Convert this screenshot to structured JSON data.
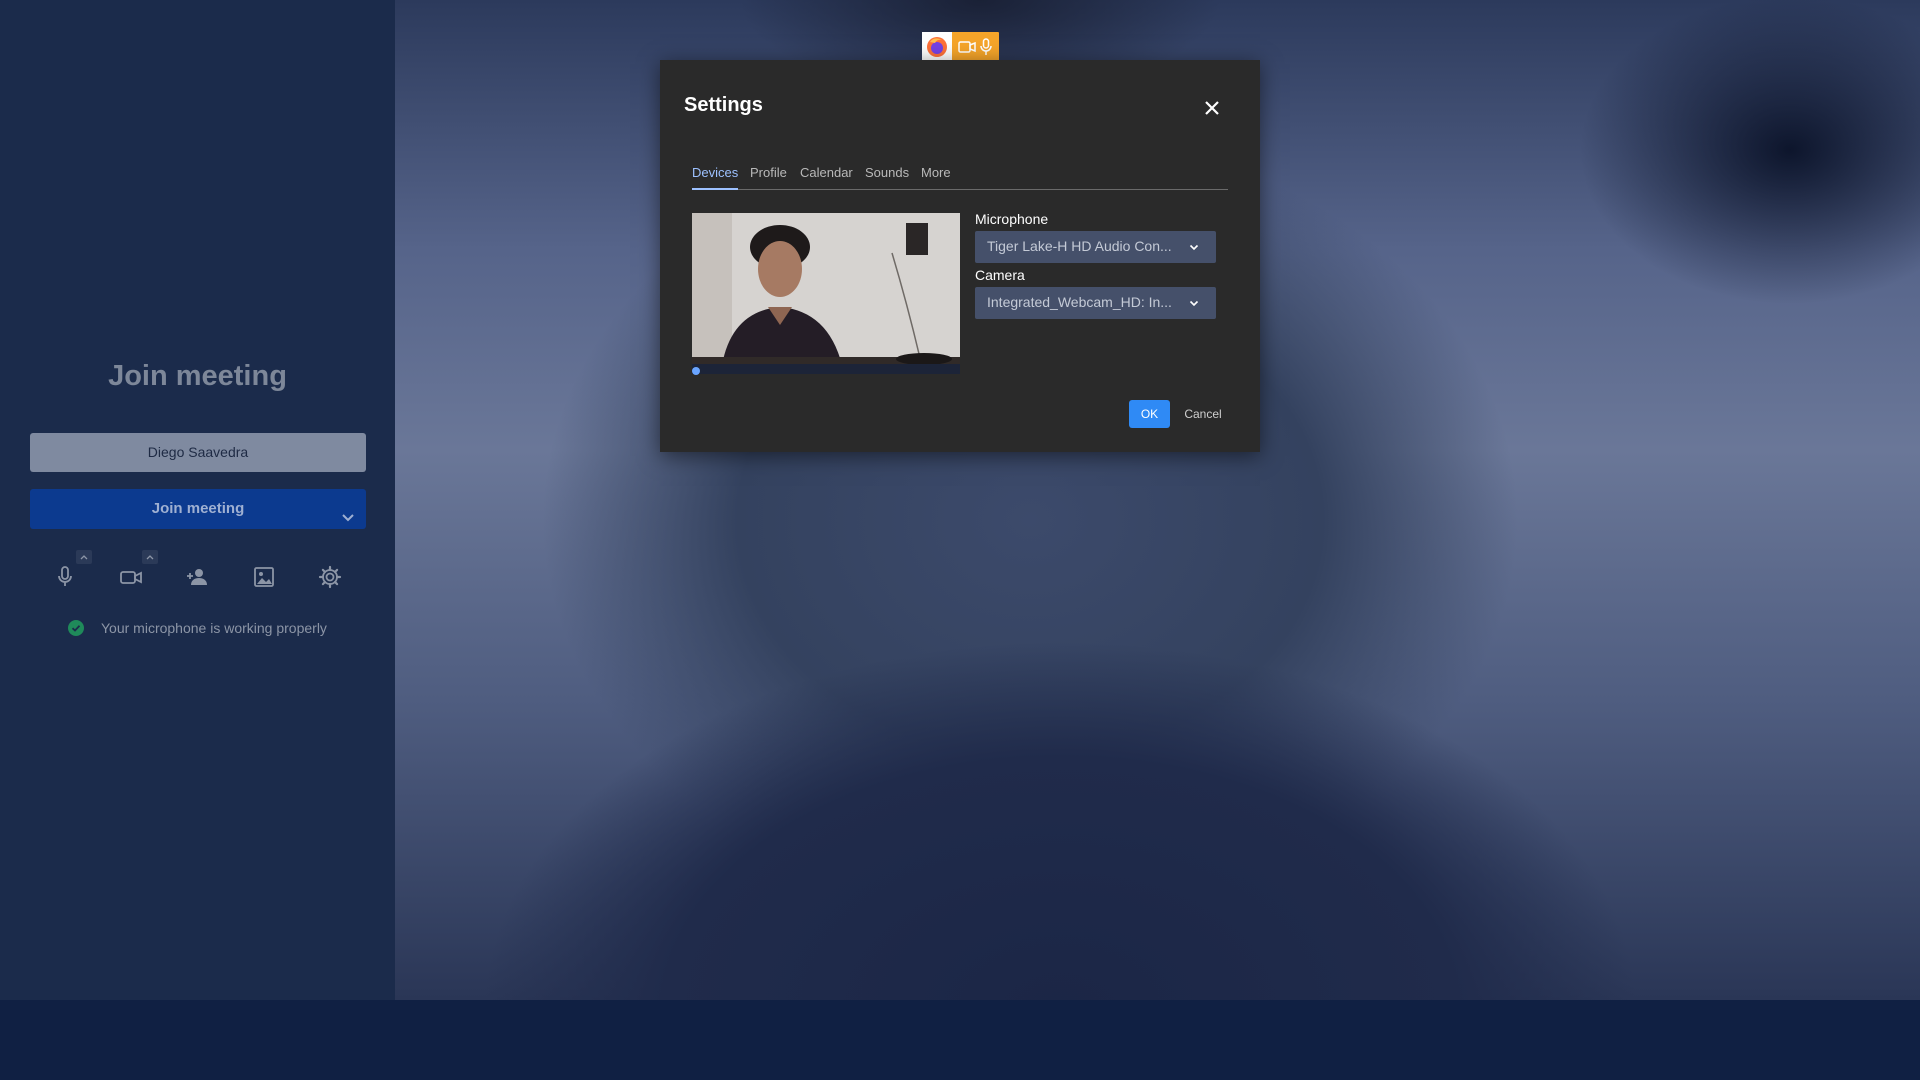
{
  "join_panel": {
    "title": "Join meeting",
    "name_value": "Diego Saavedra",
    "join_button_label": "Join meeting",
    "mic_status_text": "Your microphone is working properly"
  },
  "toolbar": {
    "icons": [
      "microphone-icon",
      "camera-icon",
      "invite-person-icon",
      "background-image-icon",
      "settings-gear-icon"
    ]
  },
  "sharing_indicator": {
    "icons": [
      "firefox-icon",
      "camera-icon",
      "microphone-icon"
    ]
  },
  "settings_dialog": {
    "title": "Settings",
    "tabs": [
      "Devices",
      "Profile",
      "Calendar",
      "Sounds",
      "More"
    ],
    "active_tab": "Devices",
    "microphone_label": "Microphone",
    "microphone_value": "Tiger Lake-H HD Audio Con...",
    "camera_label": "Camera",
    "camera_value": "Integrated_Webcam_HD: In...",
    "ok_label": "OK",
    "cancel_label": "Cancel"
  },
  "colors": {
    "panel_bg": "#1b2b4b",
    "join_button": "#0c3a8f",
    "dialog_bg": "#2a2a2a",
    "primary_button": "#2f8af5",
    "active_tab": "#9dc1ff",
    "indicator": "#f6a52a"
  }
}
